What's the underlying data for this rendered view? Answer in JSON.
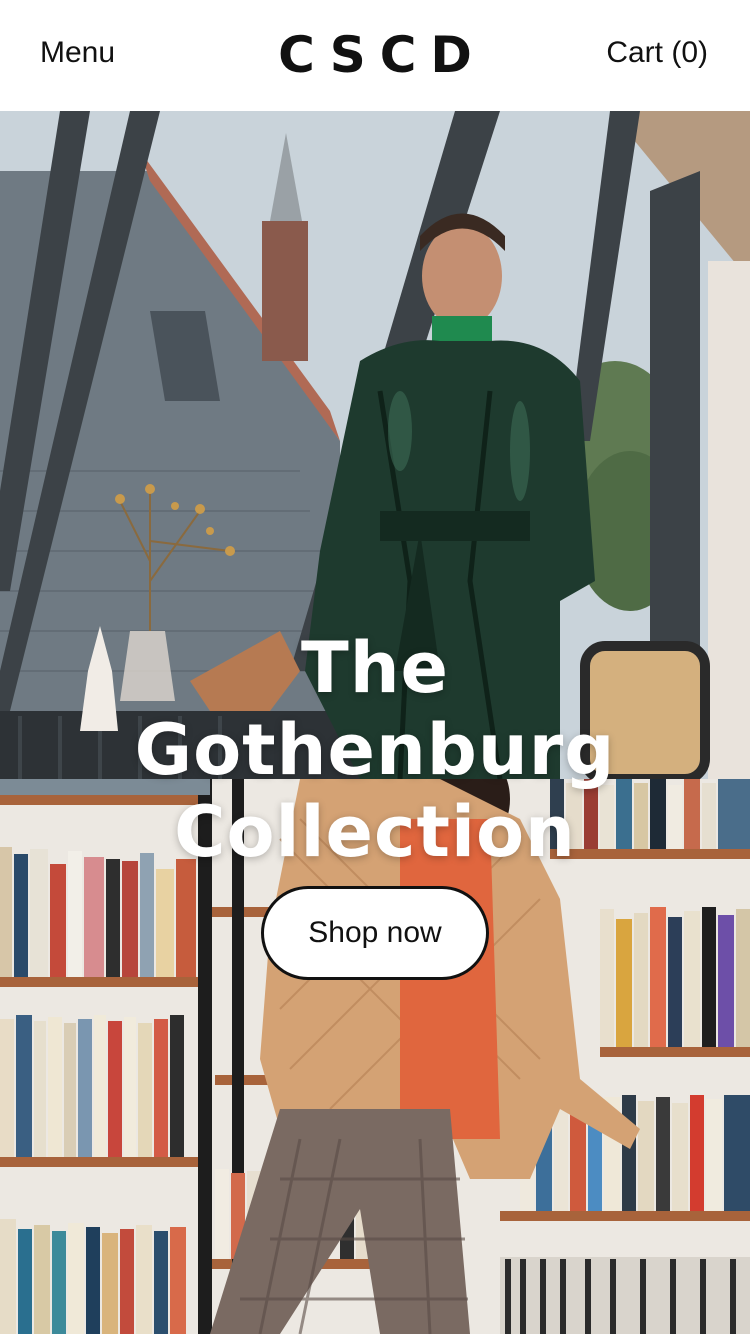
{
  "header": {
    "menu_label": "Menu",
    "brand": "CSCD",
    "cart_label": "Cart (0)"
  },
  "hero": {
    "headline_lines": [
      "The",
      "Gothenburg",
      "Collection"
    ],
    "cta_label": "Shop now"
  },
  "colors": {
    "header_bg": "#ffffff",
    "text": "#111111",
    "headline": "#ffffff",
    "button_bg": "#ffffff",
    "button_border": "#111111"
  }
}
